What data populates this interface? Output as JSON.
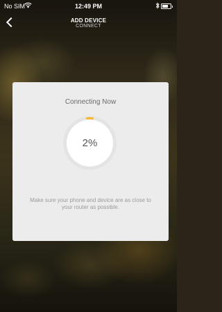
{
  "status_bar": {
    "carrier": "No SIM",
    "time": "12:49 PM",
    "icons": [
      "wifi-icon",
      "bluetooth-icon",
      "battery-icon"
    ]
  },
  "nav": {
    "title": "ADD DEVICE",
    "subtitle": "CONNECT",
    "back_icon": "chevron-left-icon"
  },
  "card": {
    "title": "Connecting Now",
    "progress_text": "2%",
    "progress_fraction": 0.02,
    "hint": "Make sure your phone and device are as close to your router as possible."
  },
  "colors": {
    "accent": "#f5b731",
    "card_bg": "#ececec",
    "ring_track": "#e4e4e4"
  }
}
